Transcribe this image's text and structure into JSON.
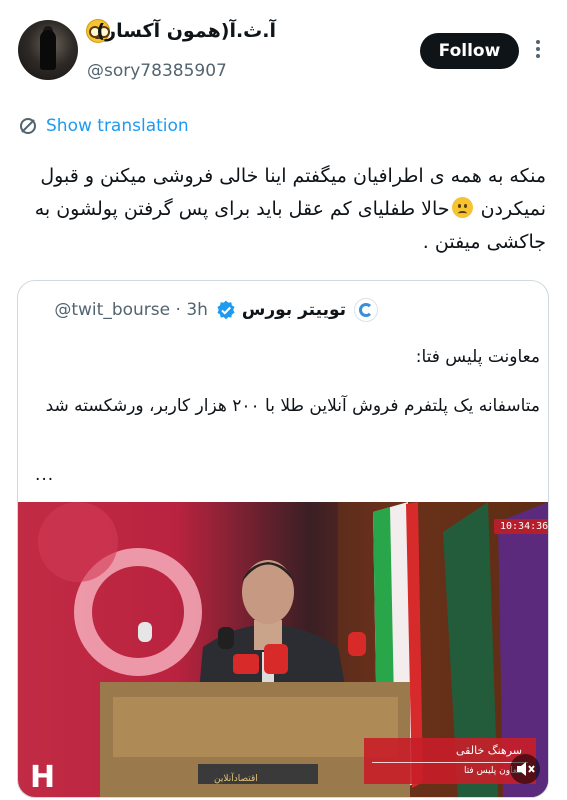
{
  "author": {
    "display_name": "آ.ث.آ(همون آکسار)",
    "emoji_icon": "face-with-glasses-emoji",
    "handle": "@sory78385907"
  },
  "actions": {
    "follow_label": "Follow",
    "more_icon": "more-vertical-icon"
  },
  "translate": {
    "label": "Show translation",
    "icon": "translate-icon"
  },
  "tweet": {
    "text_part1": "منکه به همه ی اطرافیان میگفتم اینا خالی فروشی میکنن و قبول نمیکردن ",
    "emoji_icon": "sad-face-emoji",
    "text_part2": "حالا طفلیای کم عقل باید برای پس گرفتن پولشون به جاکشی میفتن ."
  },
  "quote": {
    "name": "توییتر بورس",
    "handle": "@twit_bourse",
    "time": "3h",
    "paragraph1": "معاونت پلیس فتا:",
    "paragraph2": "متاسفانه یک پلتفرم فروش آنلاین طلا با ۲۰۰ هزار کاربر، ورشکسته شد",
    "ellipsis": "...",
    "verified_color": "#1d9bf0"
  },
  "media": {
    "timestamp": "10:34:36",
    "caption_name": "سرهنگ خالقی",
    "caption_title": "معاون پلیس فتا",
    "podium_text": "اقتصادآنلاین",
    "mute_icon": "mute-icon"
  },
  "colors": {
    "accent": "#1d9bf0",
    "text": "#0f1419",
    "muted": "#536471",
    "follow_bg": "#0f1419"
  }
}
